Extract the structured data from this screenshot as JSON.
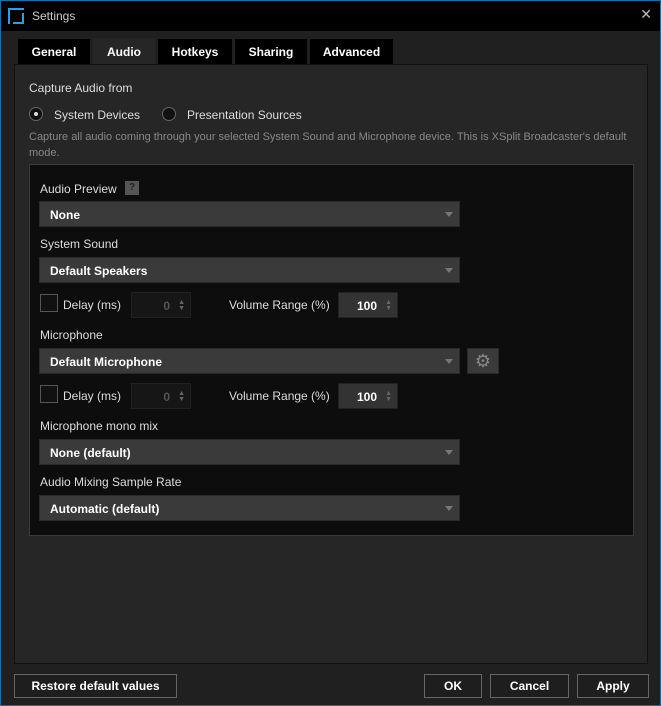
{
  "window": {
    "title": "Settings",
    "close": "✕"
  },
  "tabs": [
    "General",
    "Audio",
    "Hotkeys",
    "Sharing",
    "Advanced"
  ],
  "capture": {
    "label": "Capture Audio from",
    "options": [
      "System Devices",
      "Presentation Sources"
    ],
    "selected": "System Devices",
    "description": "Capture all audio coming through your selected System Sound and Microphone device. This is XSplit Broadcaster's default mode."
  },
  "audio_preview": {
    "label": "Audio Preview",
    "help": "?",
    "value": "None"
  },
  "system_sound": {
    "label": "System Sound",
    "value": "Default Speakers",
    "delay_label": "Delay (ms)",
    "delay": "0",
    "volume_label": "Volume Range (%)",
    "volume": "100"
  },
  "microphone": {
    "label": "Microphone",
    "value": "Default Microphone",
    "delay_label": "Delay (ms)",
    "delay": "0",
    "volume_label": "Volume Range (%)",
    "volume": "100"
  },
  "mono_mix": {
    "label": "Microphone mono mix",
    "value": "None (default)"
  },
  "sample_rate": {
    "label": "Audio Mixing Sample Rate",
    "value": "Automatic (default)"
  },
  "footer": {
    "restore": "Restore default values",
    "ok": "OK",
    "cancel": "Cancel",
    "apply": "Apply"
  }
}
